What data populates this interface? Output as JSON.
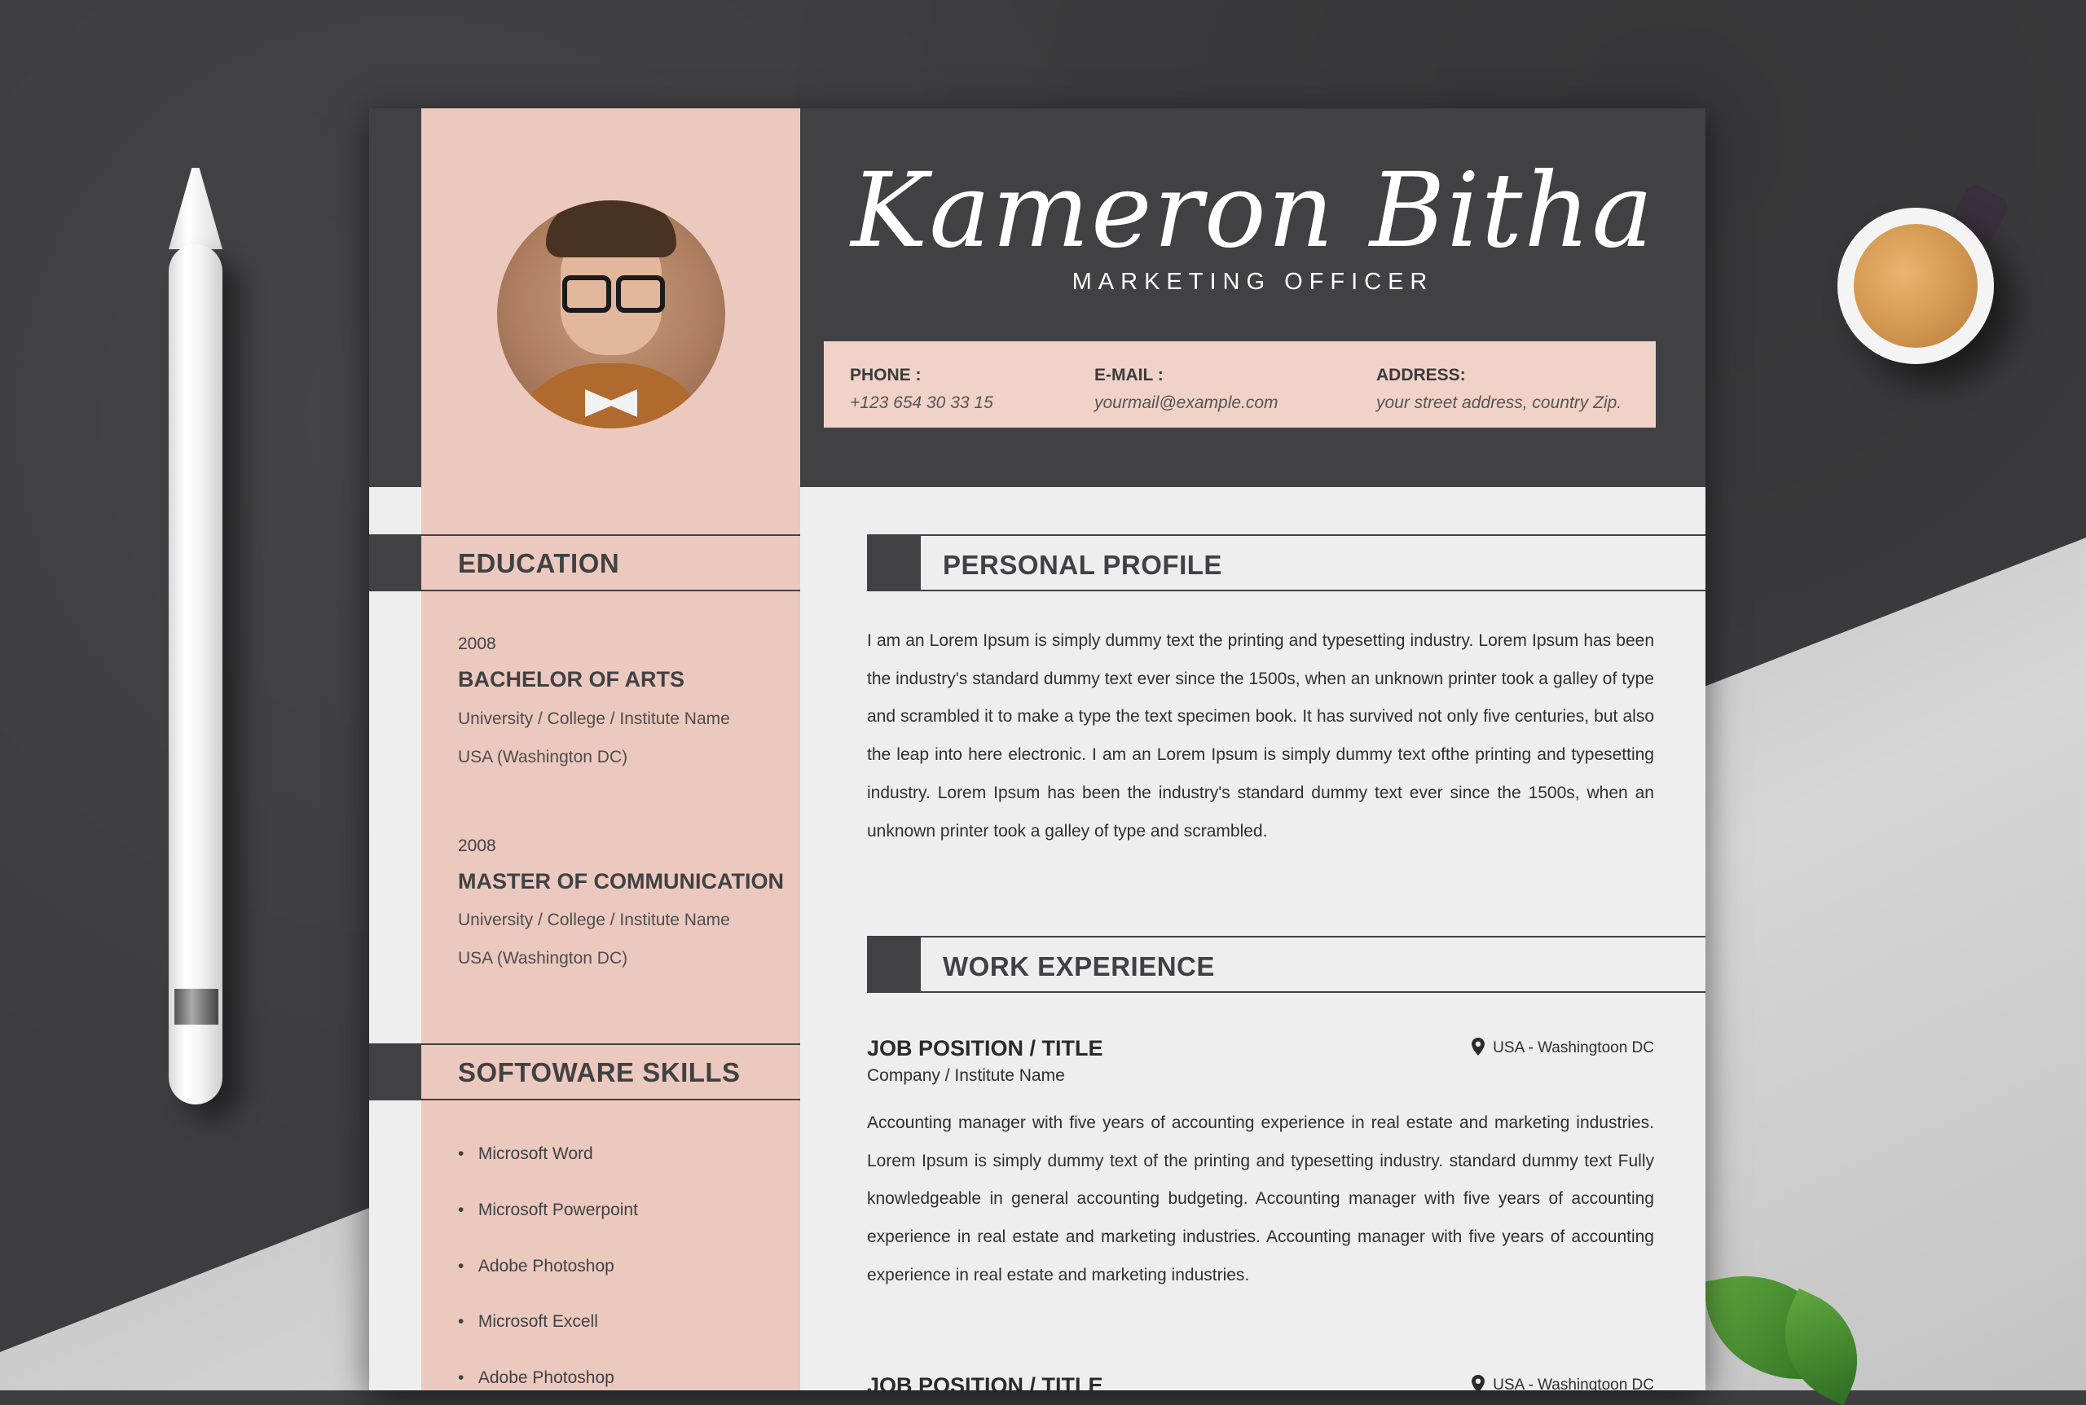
{
  "header": {
    "name": "Kameron Bitha",
    "title": "MARKETING OFFICER"
  },
  "contact": {
    "phone_label": "PHONE :",
    "phone": "+123 654 30 33 15",
    "email_label": "E-MAIL :",
    "email": "yourmail@example.com",
    "address_label": "ADDRESS:",
    "address": "your street address, country Zip."
  },
  "education": {
    "heading": "EDUCATION",
    "items": [
      {
        "year": "2008",
        "degree": "BACHELOR OF ARTS",
        "institute": "University / College / Institute Name",
        "location": "USA (Washington DC)"
      },
      {
        "year": "2008",
        "degree": "MASTER OF COMMUNICATION",
        "institute": "University / College / Institute Name",
        "location": "USA (Washington DC)"
      }
    ]
  },
  "skills": {
    "heading": "SOFTOWARE SKILLS",
    "items": [
      "Microsoft Word",
      "Microsoft Powerpoint",
      "Adobe Photoshop",
      "Microsoft Excell",
      "Adobe Photoshop"
    ]
  },
  "profile": {
    "heading": "PERSONAL PROFILE",
    "text": "I am an Lorem Ipsum is simply dummy text the printing and typesetting industry. Lorem Ipsum has been the industry's standard dummy text ever since the 1500s, when an unknown printer took a galley of type and scrambled it to make a type the text specimen book. It has survived not only five centuries, but also the leap into here electronic. I am an Lorem Ipsum is simply dummy text ofthe printing and typesetting industry. Lorem Ipsum has been the industry's standard dummy text ever since the 1500s, when an unknown printer took a galley of type and scrambled."
  },
  "experience": {
    "heading": "WORK EXPERIENCE",
    "jobs": [
      {
        "title": "JOB POSITION / TITLE",
        "company": "Company / Institute Name",
        "location": "USA - Washingtoon DC",
        "description": "Accounting manager with five years of accounting experience in real estate and marketing industries. Lorem Ipsum is simply dummy text of the printing and typesetting industry. standard dummy text Fully knowledgeable in general accounting budgeting. Accounting manager with five years of accounting experience in real estate and marketing industries. Accounting manager with five years of accounting experience in real estate and marketing industries."
      },
      {
        "title": "JOB POSITION / TITLE",
        "location": "USA - Washingtoon DC"
      }
    ]
  },
  "icons": {
    "location": "location-pin-icon"
  },
  "colors": {
    "dark": "#414144",
    "blush": "#ecc9bf",
    "contact_bg": "#f0d2c8",
    "paper": "#eeeeee"
  }
}
